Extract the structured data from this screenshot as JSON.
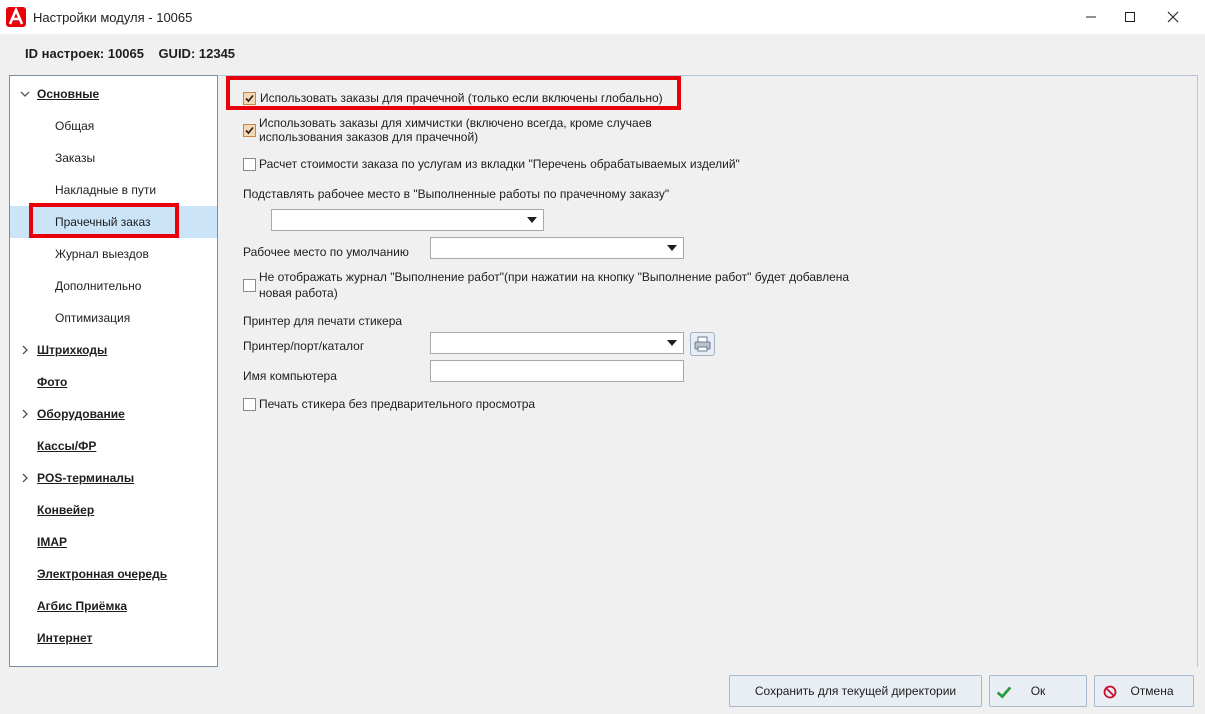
{
  "window": {
    "title": "Настройки модуля - 10065",
    "id_line": "ID настроек: 10065    GUID: 12345",
    "accent": "#e8000b"
  },
  "sidebar": {
    "categories": {
      "osnovnye": "Основные",
      "shtrihkody": "Штрихкоды",
      "foto": "Фото",
      "oborudovanie": "Оборудование",
      "kassy": "Кассы/ФР",
      "pos": "POS-терминалы",
      "konveyer": "Конвейер",
      "imap": "IMAP",
      "ochered": "Электронная очередь",
      "agbis": "Агбис Приёмка",
      "internet": "Интернет"
    },
    "subitems": {
      "obshaya": "Общая",
      "zakazy": "Заказы",
      "nakladnye": "Накладные в пути",
      "prachechny": "Прачечный заказ",
      "zhurnal": "Журнал выездов",
      "dopolnitelno": "Дополнительно",
      "optimizaciya": "Оптимизация"
    },
    "selected": "Прачечный заказ"
  },
  "form": {
    "use_laundry": {
      "label": "Использовать заказы для прачечной (только если включены глобально)",
      "checked": true
    },
    "use_dry": {
      "label_line1": "Использовать заказы для химчистки (включено всегда, кроме случаев",
      "label_line2": "использования заказов для прачечной)",
      "checked": true
    },
    "calc_cost": {
      "label": "Расчет стоимости заказа по услугам из вкладки \"Перечень обрабатываемых изделий\"",
      "checked": false
    },
    "substitute_label": "Подставлять рабочее место в \"Выполненные работы по прачечному заказу\"",
    "substitute_value": "",
    "default_workplace_label": "Рабочее место по умолчанию",
    "default_workplace_value": "",
    "no_journal": {
      "label_line1": "Не отображать журнал \"Выполнение работ\"(при нажатии на кнопку \"Выполнение работ\" будет добавлена",
      "label_line2": "новая работа)",
      "checked": false
    },
    "sticker_printer_title": "Принтер для печати стикера",
    "printer_label": "Принтер/порт/каталог",
    "printer_value": "",
    "computer_label": "Имя компьютера",
    "computer_value": "",
    "no_preview": {
      "label": "Печать стикера без предварительного просмотра",
      "checked": false
    }
  },
  "footer": {
    "save_label": "Сохранить для текущей директории",
    "ok_label": "Ок",
    "cancel_label": "Отмена"
  },
  "icons": [
    "app-logo",
    "minimize-icon",
    "maximize-icon",
    "close-icon",
    "chevron-down-icon",
    "chevron-right-icon",
    "printer-icon",
    "check-icon",
    "cancel-icon"
  ]
}
